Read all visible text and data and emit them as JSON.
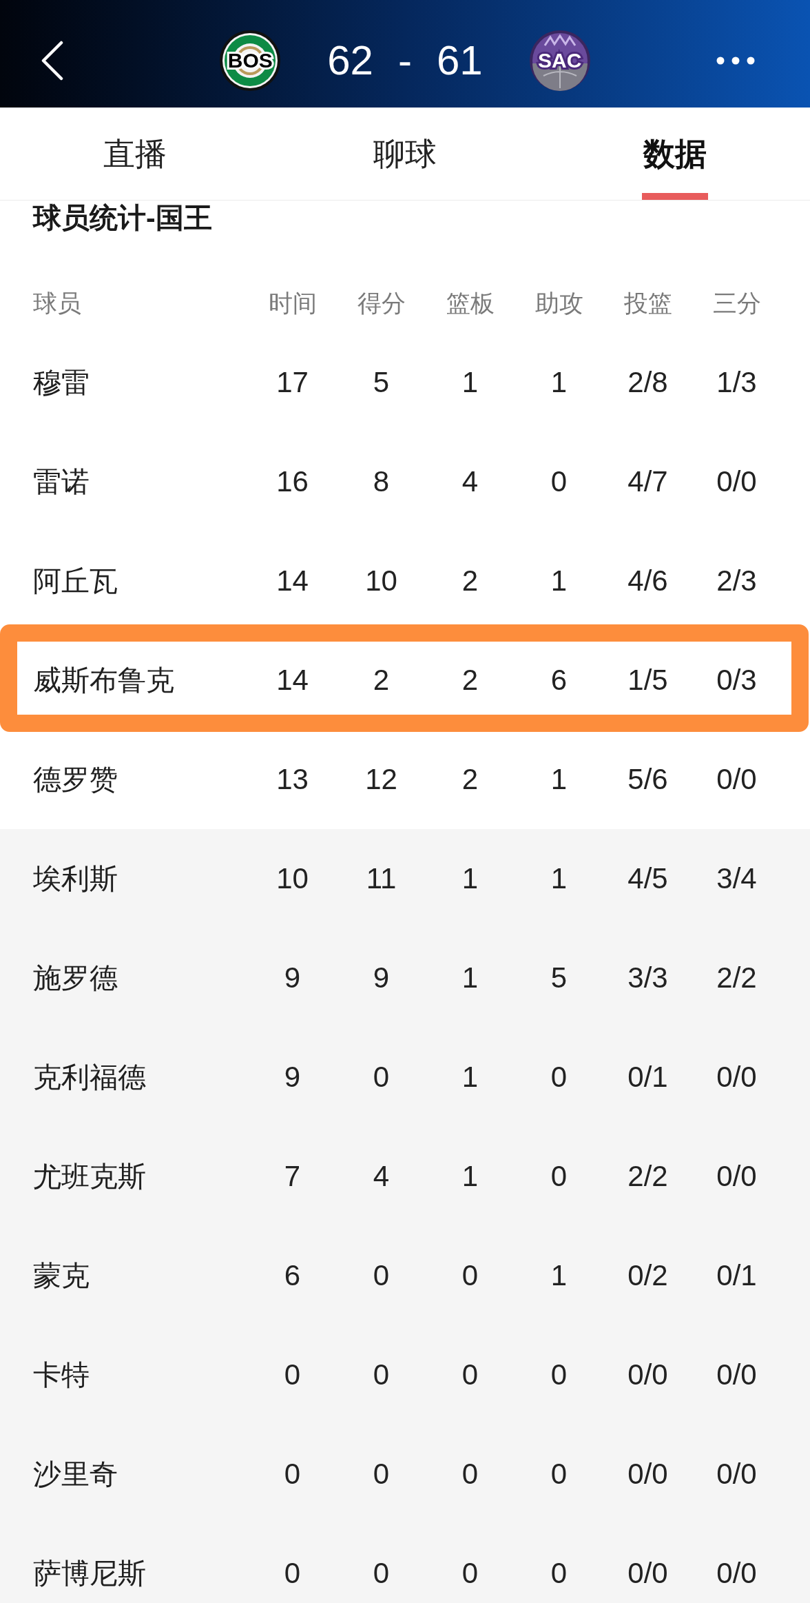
{
  "header": {
    "home_team": {
      "abbr": "BOS"
    },
    "score_home": "62",
    "score_separator": "-",
    "score_away": "61",
    "away_team": {
      "abbr": "SAC"
    }
  },
  "tabs": [
    {
      "label": "直播",
      "selected": false
    },
    {
      "label": "聊球",
      "selected": false
    },
    {
      "label": "数据",
      "selected": true
    }
  ],
  "section_title": "球员统计-国王",
  "table": {
    "columns": [
      "球员",
      "时间",
      "得分",
      "篮板",
      "助攻",
      "投篮",
      "三分"
    ],
    "rows": [
      {
        "kind": "starter",
        "highlighted": false,
        "cells": [
          "穆雷",
          "17",
          "5",
          "1",
          "1",
          "2/8",
          "1/3"
        ]
      },
      {
        "kind": "starter",
        "highlighted": false,
        "cells": [
          "雷诺",
          "16",
          "8",
          "4",
          "0",
          "4/7",
          "0/0"
        ]
      },
      {
        "kind": "starter",
        "highlighted": false,
        "cells": [
          "阿丘瓦",
          "14",
          "10",
          "2",
          "1",
          "4/6",
          "2/3"
        ]
      },
      {
        "kind": "starter",
        "highlighted": true,
        "cells": [
          "威斯布鲁克",
          "14",
          "2",
          "2",
          "6",
          "1/5",
          "0/3"
        ]
      },
      {
        "kind": "starter",
        "highlighted": false,
        "cells": [
          "德罗赞",
          "13",
          "12",
          "2",
          "1",
          "5/6",
          "0/0"
        ]
      },
      {
        "kind": "bench",
        "highlighted": false,
        "cells": [
          "埃利斯",
          "10",
          "11",
          "1",
          "1",
          "4/5",
          "3/4"
        ]
      },
      {
        "kind": "bench",
        "highlighted": false,
        "cells": [
          "施罗德",
          "9",
          "9",
          "1",
          "5",
          "3/3",
          "2/2"
        ]
      },
      {
        "kind": "bench",
        "highlighted": false,
        "cells": [
          "克利福德",
          "9",
          "0",
          "1",
          "0",
          "0/1",
          "0/0"
        ]
      },
      {
        "kind": "bench",
        "highlighted": false,
        "cells": [
          "尤班克斯",
          "7",
          "4",
          "1",
          "0",
          "2/2",
          "0/0"
        ]
      },
      {
        "kind": "bench",
        "highlighted": false,
        "cells": [
          "蒙克",
          "6",
          "0",
          "0",
          "1",
          "0/2",
          "0/1"
        ]
      },
      {
        "kind": "bench",
        "highlighted": false,
        "cells": [
          "卡特",
          "0",
          "0",
          "0",
          "0",
          "0/0",
          "0/0"
        ]
      },
      {
        "kind": "bench",
        "highlighted": false,
        "cells": [
          "沙里奇",
          "0",
          "0",
          "0",
          "0",
          "0/0",
          "0/0"
        ]
      },
      {
        "kind": "bench",
        "highlighted": false,
        "cells": [
          "萨博尼斯",
          "0",
          "0",
          "0",
          "0",
          "0/0",
          "0/0"
        ]
      }
    ]
  }
}
